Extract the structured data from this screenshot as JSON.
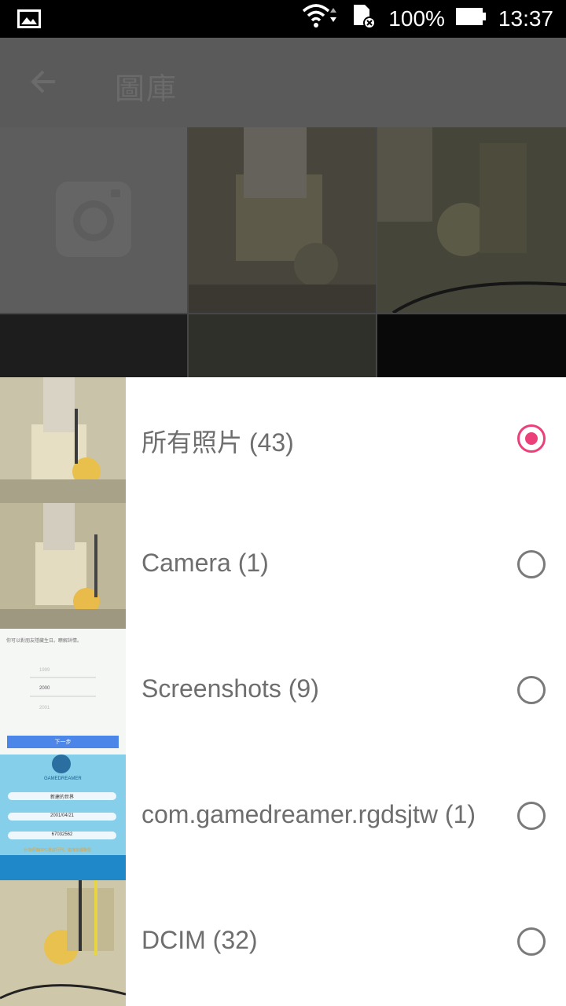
{
  "status_bar": {
    "battery": "100%",
    "time": "13:37",
    "icons": [
      "image-icon",
      "wifi-icon",
      "sd-card-icon",
      "battery-icon"
    ]
  },
  "app_bar": {
    "title": "圖庫",
    "back_icon": "arrow-left-icon"
  },
  "albums": [
    {
      "label": "所有照片 (43)",
      "selected": true
    },
    {
      "label": "Camera (1)",
      "selected": false
    },
    {
      "label": "Screenshots (9)",
      "selected": false
    },
    {
      "label": "com.gamedreamer.rgdsjtw (1)",
      "selected": false
    },
    {
      "label": "DCIM (32)",
      "selected": false
    }
  ],
  "thumb_texts": {
    "screenshot_line": "你可以對朋友隱藏生日。瞭解詳情。",
    "screenshot_button": "下一步",
    "game_logo": "GAMEDREAMER",
    "game_field_1": "新建的世界",
    "game_field_2": "2001/04/21",
    "game_field_3": "67032562",
    "game_link": "台灣經典RPG重返行列，連接遊戲聯盟"
  },
  "colors": {
    "accent": "#ec407a",
    "appbar": "#8a8a8a",
    "label": "#6e6e6e"
  }
}
